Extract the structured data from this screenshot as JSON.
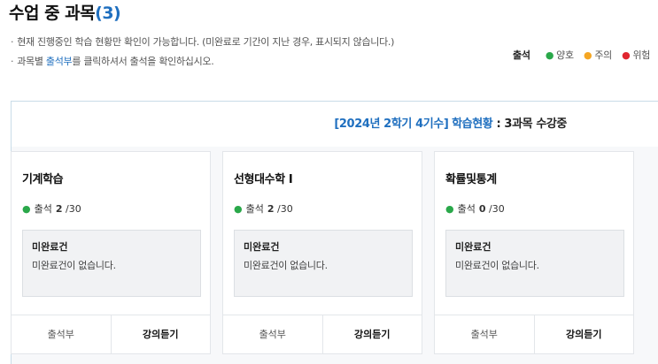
{
  "page": {
    "title": "수업 중 과목",
    "title_count": "(3)",
    "notes": [
      "현재 진행중인 학습 현황만 확인이 가능합니다. (미완료로 기간이 지난 경우, 표시되지 않습니다.)",
      {
        "prefix": "과목별 ",
        "link": "출석부",
        "suffix": "를 클릭하셔서 출석을 확인하십시오."
      }
    ],
    "note_bullet": "·"
  },
  "legend": {
    "label": "출석",
    "items": [
      {
        "text": "양호",
        "color": "#2aa84a"
      },
      {
        "text": "주의",
        "color": "#f5a623"
      },
      {
        "text": "위험",
        "color": "#e0262f"
      }
    ]
  },
  "panel": {
    "term": "[2024년 2학기 4기수]",
    "status_link": "학습현황",
    "summary": " : 3과목 수강중"
  },
  "courses": [
    {
      "name": "기계학습",
      "att_label": "출석",
      "att_count": "2",
      "att_total": "/30",
      "status_color": "#2aa84a",
      "box_title": "미완료건",
      "box_text": "미완료건이 없습니다.",
      "btn_left": "출석부",
      "btn_right": "강의듣기"
    },
    {
      "name": "선형대수학 I",
      "att_label": "출석",
      "att_count": "2",
      "att_total": "/30",
      "status_color": "#2aa84a",
      "box_title": "미완료건",
      "box_text": "미완료건이 없습니다.",
      "btn_left": "출석부",
      "btn_right": "강의듣기"
    },
    {
      "name": "확률및통계",
      "att_label": "출석",
      "att_count": "0",
      "att_total": "/30",
      "status_color": "#2aa84a",
      "box_title": "미완료건",
      "box_text": "미완료건이 없습니다.",
      "btn_left": "출석부",
      "btn_right": "강의듣기"
    }
  ]
}
